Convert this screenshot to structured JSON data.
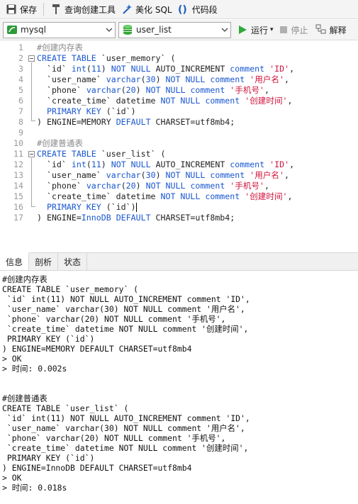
{
  "toolbar": {
    "save": "保存",
    "query_builder": "查询创建工具",
    "beautify": "美化 SQL",
    "snippet": "代码段"
  },
  "toolbar2": {
    "connection": "mysql",
    "database": "user_list",
    "run": "运行",
    "run_arrow": "▾",
    "stop": "停止",
    "explain": "解释"
  },
  "editor": {
    "line_numbers": [
      "1",
      "2",
      "3",
      "4",
      "5",
      "6",
      "7",
      "8",
      "9",
      "10",
      "11",
      "12",
      "13",
      "14",
      "15",
      "16",
      "17"
    ]
  },
  "tabs": [
    "信息",
    "剖析",
    "状态"
  ],
  "info": {
    "lines": [
      "#创建内存表",
      "CREATE TABLE `user_memory` (",
      " `id` int(11) NOT NULL AUTO_INCREMENT comment 'ID',",
      " `user_name` varchar(30) NOT NULL comment '用户名',",
      " `phone` varchar(20) NOT NULL comment '手机号',",
      " `create_time` datetime NOT NULL comment '创建时间',",
      " PRIMARY KEY (`id`)",
      ") ENGINE=MEMORY DEFAULT CHARSET=utf8mb4",
      "> OK",
      "> 时间: 0.002s",
      "",
      "",
      "#创建普通表",
      "CREATE TABLE `user_list` (",
      " `id` int(11) NOT NULL AUTO_INCREMENT comment 'ID',",
      " `user_name` varchar(30) NOT NULL comment '用户名',",
      " `phone` varchar(20) NOT NULL comment '手机号',",
      " `create_time` datetime NOT NULL comment '创建时间',",
      " PRIMARY KEY (`id`)",
      ") ENGINE=InnoDB DEFAULT CHARSET=utf8mb4",
      "> OK",
      "> 时间: 0.018s"
    ]
  },
  "colors": {
    "keyword": "#1a57d0",
    "string": "#d0143c",
    "comment": "#888888",
    "run_green": "#2fa93a"
  },
  "icons": {
    "save": "save-icon",
    "query_builder": "query-builder-icon",
    "beautify": "magic-wand-icon",
    "snippet": "code-snippet-icon",
    "connection": "mysql-connection-icon",
    "database": "database-icon",
    "run": "play-icon",
    "stop": "stop-icon",
    "explain": "explain-icon"
  }
}
